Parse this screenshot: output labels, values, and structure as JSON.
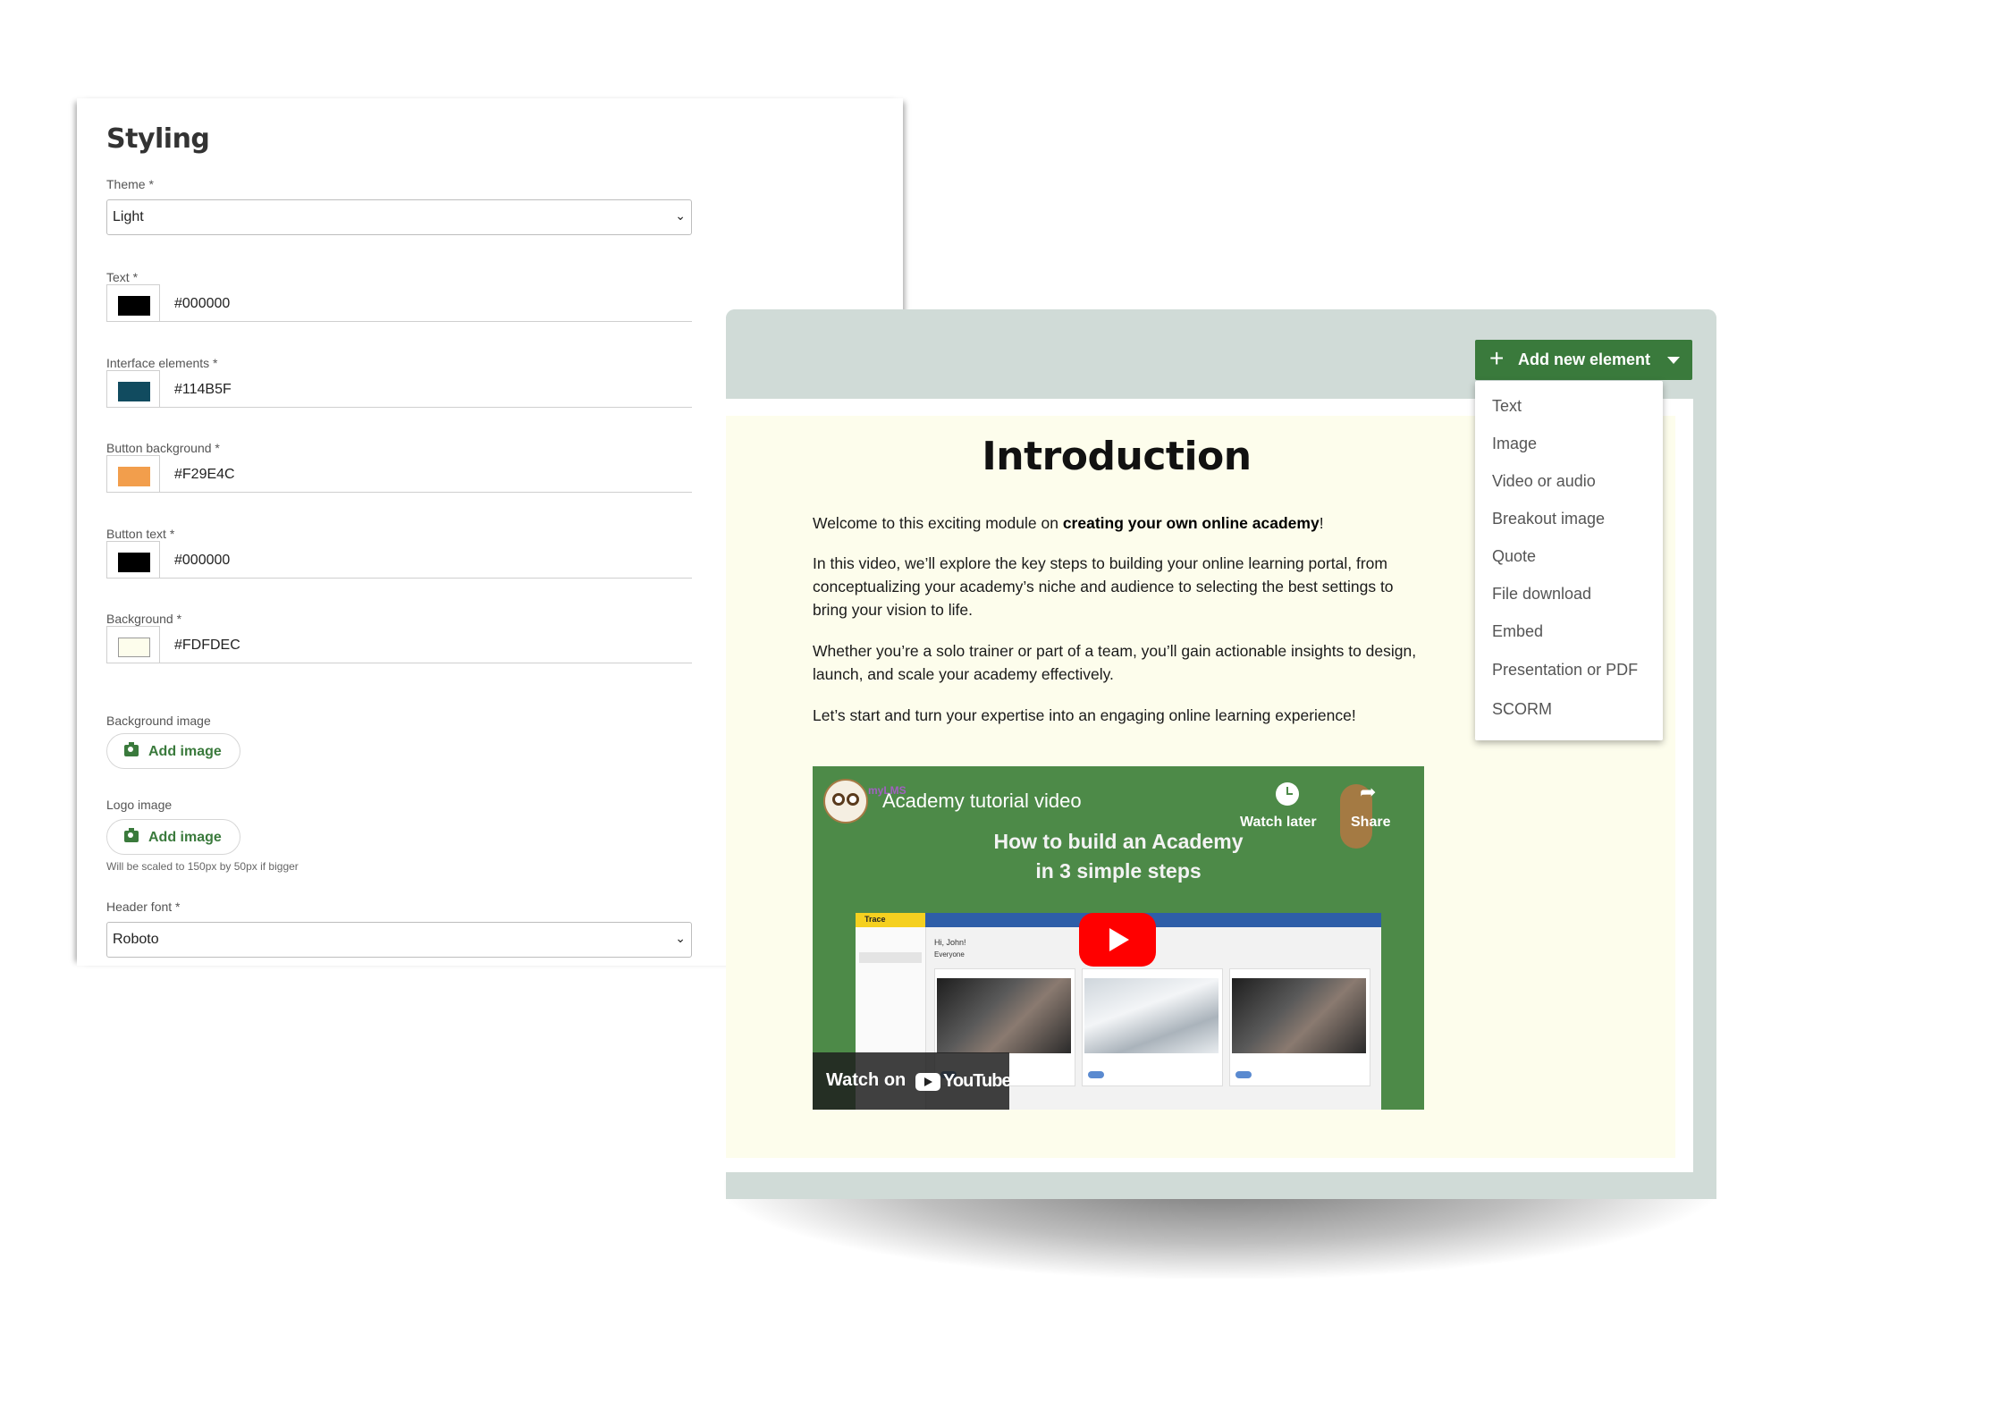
{
  "styling": {
    "title": "Styling",
    "theme": {
      "label": "Theme *",
      "value": "Light"
    },
    "colors": [
      {
        "label": "Text *",
        "hex": "#000000",
        "swatch": "#000000"
      },
      {
        "label": "Interface elements *",
        "hex": "#114B5F",
        "swatch": "#114B5F"
      },
      {
        "label": "Button background *",
        "hex": "#F29E4C",
        "swatch": "#F29E4C"
      },
      {
        "label": "Button text *",
        "hex": "#000000",
        "swatch": "#000000"
      },
      {
        "label": "Background *",
        "hex": "#FDFDEC",
        "swatch": "#FDFDEC"
      }
    ],
    "background_image": {
      "label": "Background image",
      "button": "Add image"
    },
    "logo_image": {
      "label": "Logo image",
      "button": "Add image",
      "hint": "Will be scaled to 150px by 50px if bigger"
    },
    "header_font": {
      "label": "Header font *",
      "value": "Roboto"
    }
  },
  "editor": {
    "add_button": "Add new element",
    "menu": [
      "Text",
      "Image",
      "Video or audio",
      "Breakout image",
      "Quote",
      "File download",
      "Embed",
      "Presentation or PDF",
      "SCORM"
    ],
    "page": {
      "title": "Introduction",
      "p1_pre": "Welcome to this exciting module on ",
      "p1_bold": "creating your own online academy",
      "p1_post": "!",
      "p2": "In this video, we’ll explore the key steps to building your online learning portal, from conceptualizing your academy’s niche and audience to selecting the best settings to bring your vision to life.",
      "p3": "Whether you’re a solo trainer or part of a team, you’ll gain actionable insights to design, launch, and scale your academy effectively.",
      "p4": "Let’s start and turn your expertise into an engaging online learning experience!"
    },
    "video": {
      "brand": "myLMS",
      "title": "Academy tutorial video",
      "subtitle_line1": "How to build an Academy",
      "subtitle_line2": "in 3 simple steps",
      "watch_later": "Watch later",
      "share": "Share",
      "watch_on": "Watch on",
      "youtube": "YouTube",
      "mock_logo": "Trace",
      "mock_greeting": "Hi, John!",
      "mock_group": "Everyone"
    }
  }
}
